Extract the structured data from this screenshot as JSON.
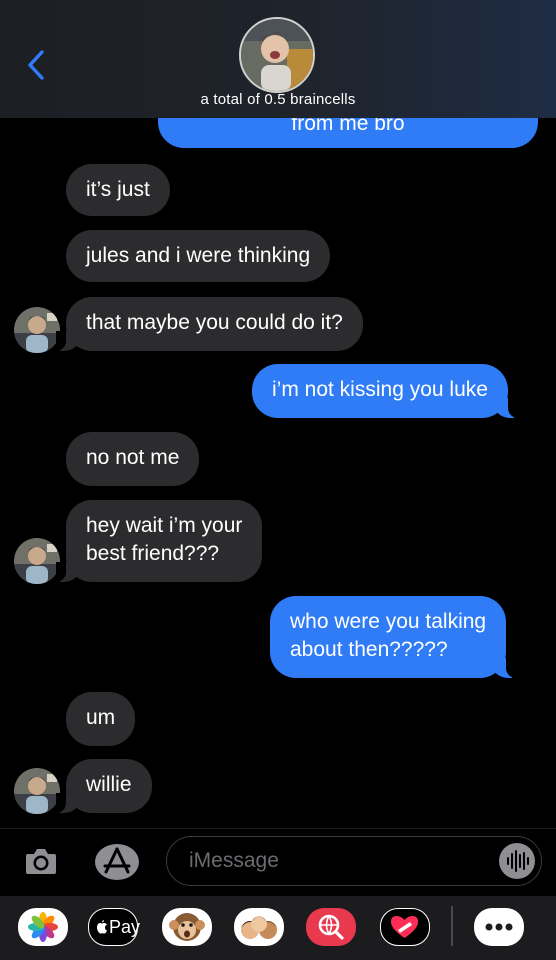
{
  "header": {
    "group_name": "a total of 0.5 braincells",
    "back_icon": "chevron-left-icon"
  },
  "messages": [
    {
      "from": "me",
      "text": "from me bro"
    },
    {
      "from": "them",
      "text": "it’s just"
    },
    {
      "from": "them",
      "text": "jules and i were thinking"
    },
    {
      "from": "them",
      "text": "that maybe you could do it?"
    },
    {
      "from": "me",
      "text": "i’m not kissing you luke"
    },
    {
      "from": "them",
      "text": "no not me"
    },
    {
      "from": "them",
      "lines": [
        "hey wait i’m your",
        "best friend???"
      ]
    },
    {
      "from": "me",
      "lines": [
        "who were you talking",
        "about then?????"
      ]
    },
    {
      "from": "them",
      "text": "um"
    },
    {
      "from": "them",
      "text": "willie"
    }
  ],
  "composer": {
    "placeholder": "iMessage",
    "camera_icon": "camera-icon",
    "apps_icon": "app-store-icon",
    "audio_icon": "waveform-icon"
  },
  "app_drawer": {
    "apple_pay_label": "Pay",
    "apps": [
      "photos-icon",
      "apple-pay-icon",
      "monkey-animoji-icon",
      "memoji-icon",
      "web-search-icon",
      "digital-touch-icon",
      "more-icon"
    ]
  },
  "colors": {
    "outgoing_bubble": "#2f7cf6",
    "incoming_bubble": "#2c2c2e",
    "background": "#000000"
  }
}
